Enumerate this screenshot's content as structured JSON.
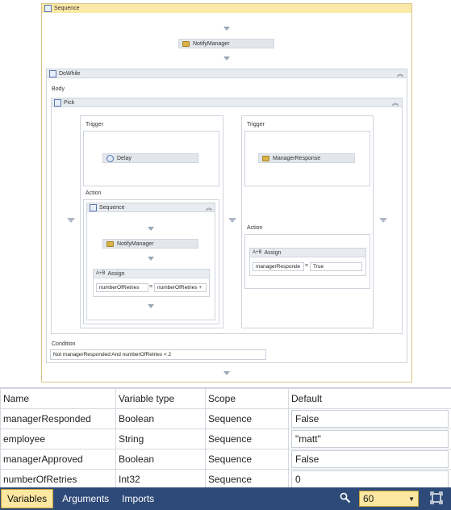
{
  "designer": {
    "outer_sequence": "Sequence",
    "notify_top": "NotifyManager",
    "dowhile": "DoWhile",
    "body_label": "Body",
    "pick": "Pick",
    "branch1": {
      "trigger_label": "Trigger",
      "trigger_activity": "Delay",
      "action_label": "Action",
      "inner_sequence": "Sequence",
      "inner_notify": "NotifyManager",
      "assign": "Assign",
      "assign_to": "numberOfRetries",
      "assign_eq": "=",
      "assign_value": "numberOfRetries +"
    },
    "branch2": {
      "trigger_label": "Trigger",
      "trigger_activity": "ManagerResponse",
      "action_label": "Action",
      "assign": "Assign",
      "assign_to": "managerResponde",
      "assign_eq": "=",
      "assign_value": "True"
    },
    "condition_label": "Condition",
    "condition_value": "Not managerResponded And numberOfRetries < 2"
  },
  "variables": {
    "headers": [
      "Name",
      "Variable type",
      "Scope",
      "Default"
    ],
    "rows": [
      {
        "name": "managerResponded",
        "type": "Boolean",
        "scope": "Sequence",
        "default": "False"
      },
      {
        "name": "employee",
        "type": "String",
        "scope": "Sequence",
        "default": "\"matt\""
      },
      {
        "name": "managerApproved",
        "type": "Boolean",
        "scope": "Sequence",
        "default": "False"
      },
      {
        "name": "numberOfRetries",
        "type": "Int32",
        "scope": "Sequence",
        "default": "0"
      }
    ]
  },
  "bottombar": {
    "tabs": [
      "Variables",
      "Arguments",
      "Imports"
    ],
    "zoom": "60",
    "icons": [
      "search-icon",
      "fit-to-screen-icon"
    ]
  },
  "colors": {
    "bar": "#2e4a78",
    "selected_tab": "#fde7a1",
    "header_yellow": "#fbe9a7"
  }
}
